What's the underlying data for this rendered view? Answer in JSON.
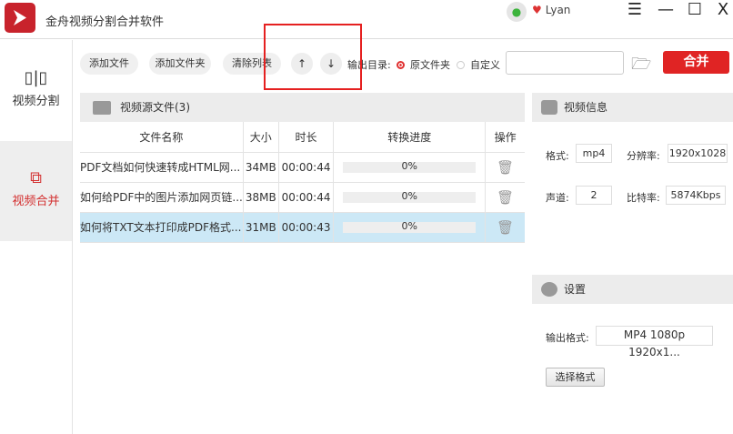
{
  "app": {
    "title": "金舟视频分割合并软件",
    "user": "Lyan"
  },
  "window_controls": {
    "menu": "☰",
    "minimize": "—",
    "maximize": "☐",
    "close": "X"
  },
  "sidebar": {
    "items": [
      {
        "label": "视频分割",
        "active": false
      },
      {
        "label": "视频合并",
        "active": true
      }
    ]
  },
  "toolbar": {
    "add_file": "添加文件",
    "add_folder": "添加文件夹",
    "clear_list": "清除列表",
    "move_up": "↑",
    "move_down": "↓",
    "output_dir_label": "输出目录:",
    "radio_source": "原文件夹",
    "radio_custom": "自定义",
    "output_path": "",
    "merge": "合并"
  },
  "source": {
    "title": "视频源文件(3)",
    "columns": [
      "文件名称",
      "大小",
      "时长",
      "转换进度",
      "操作"
    ],
    "rows": [
      {
        "name": "PDF文档如何快速转成HTML网...",
        "size": "34MB",
        "duration": "00:00:44",
        "progress": "0%"
      },
      {
        "name": "如何给PDF中的图片添加网页链...",
        "size": "38MB",
        "duration": "00:00:44",
        "progress": "0%"
      },
      {
        "name": "如何将TXT文本打印成PDF格式...",
        "size": "31MB",
        "duration": "00:00:43",
        "progress": "0%"
      }
    ]
  },
  "info": {
    "title": "视频信息",
    "format_label": "格式:",
    "format": "mp4",
    "resolution_label": "分辨率:",
    "resolution": "1920x1028",
    "channels_label": "声道:",
    "channels": "2",
    "bitrate_label": "比特率:",
    "bitrate": "5874Kbps"
  },
  "settings": {
    "title": "设置",
    "output_format_label": "输出格式:",
    "output_format": "MP4 1080p 1920x1...",
    "select_format": "选择格式"
  },
  "colors": {
    "accent": "#e02424",
    "selected_row": "#cce8f6"
  }
}
